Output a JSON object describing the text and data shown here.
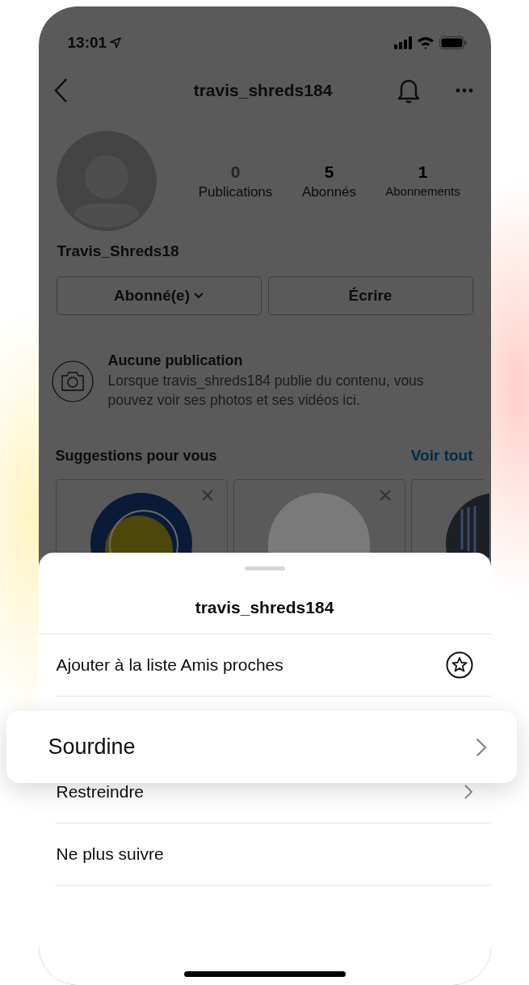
{
  "status_bar": {
    "time": "13:01"
  },
  "header": {
    "title": "travis_shreds184"
  },
  "profile": {
    "stats": [
      {
        "value": "0",
        "label": "Publications",
        "muted": true
      },
      {
        "value": "5",
        "label": "Abonnés",
        "muted": false
      },
      {
        "value": "1",
        "label": "Abonnements",
        "muted": false
      }
    ],
    "display_name": "Travis_Shreds18",
    "buttons": [
      {
        "label": "Abonné(e)",
        "kind": "dropdown"
      },
      {
        "label": "Écrire",
        "kind": "plain"
      }
    ]
  },
  "empty_state": {
    "title": "Aucune publication",
    "text": "Lorsque travis_shreds184 publie du contenu, vous pouvez voir ses photos et ses vidéos ici."
  },
  "suggestions": {
    "title": "Suggestions pour vous",
    "link": "Voir tout",
    "cards": [
      {
        "kind": "logo"
      },
      {
        "kind": "photo"
      },
      {
        "kind": "badge"
      }
    ]
  },
  "sheet": {
    "title": "travis_shreds184",
    "items": [
      {
        "label": "Ajouter à la liste Amis proches",
        "kind": "star",
        "highlighted": false
      },
      {
        "label": "Sourdine",
        "kind": "chevron",
        "highlighted": true
      },
      {
        "label": "Restreindre",
        "kind": "chevron",
        "highlighted": false
      },
      {
        "label": "Ne plus suivre",
        "kind": "plain",
        "highlighted": false
      }
    ]
  }
}
